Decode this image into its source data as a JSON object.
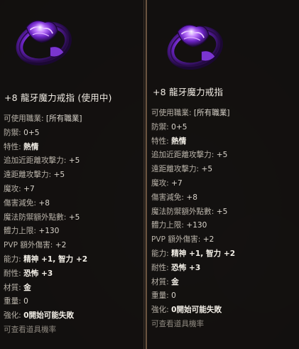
{
  "left_panel": {
    "title": "+8 龍牙魔力戒指 (使用中)",
    "stats": [
      {
        "label": "可使用職業: ",
        "value": "[所有職業]",
        "style": "plain"
      },
      {
        "label": "防禦: ",
        "value": "0+5",
        "style": "plain"
      },
      {
        "label": "特性: ",
        "value": "熱情",
        "style": "bold"
      },
      {
        "label": "追加近距離攻擊力: ",
        "value": "+5",
        "style": "plain"
      },
      {
        "label": "遠距離攻擊力: ",
        "value": "+5",
        "style": "plain"
      },
      {
        "label": "魔攻: ",
        "value": "+7",
        "style": "plain"
      },
      {
        "label": "傷害減免: ",
        "value": "+8",
        "style": "plain"
      },
      {
        "label": "魔法防禦額外點數: ",
        "value": "+5",
        "style": "plain"
      },
      {
        "label": "體力上限: ",
        "value": "+130",
        "style": "plain"
      },
      {
        "label": "PVP 額外傷害: ",
        "value": "+2",
        "style": "plain"
      },
      {
        "label": "能力: ",
        "value": "精神 +1, 智力 +2",
        "style": "bold"
      },
      {
        "label": "耐性: ",
        "value": "恐怖 +3",
        "style": "bold"
      },
      {
        "label": "材質: ",
        "value": "金",
        "style": "bold"
      },
      {
        "label": "重量: ",
        "value": "0",
        "style": "plain"
      },
      {
        "label": "強化: ",
        "value": "0開始可能失敗",
        "style": "bold"
      },
      {
        "label": "可查看道具機率",
        "value": "",
        "style": "note"
      }
    ]
  },
  "right_panel": {
    "title": "+8 龍牙魔力戒指",
    "stats": [
      {
        "label": "可使用職業: ",
        "value": "[所有職業]",
        "style": "plain"
      },
      {
        "label": "防禦: ",
        "value": "0+5",
        "style": "plain"
      },
      {
        "label": "特性: ",
        "value": "熱情",
        "style": "bold"
      },
      {
        "label": "追加近距離攻擊力: ",
        "value": "+5",
        "style": "plain"
      },
      {
        "label": "遠距離攻擊力: ",
        "value": "+5",
        "style": "plain"
      },
      {
        "label": "魔攻: ",
        "value": "+7",
        "style": "plain"
      },
      {
        "label": "傷害減免: ",
        "value": "+8",
        "style": "plain"
      },
      {
        "label": "魔法防禦額外點數: ",
        "value": "+5",
        "style": "plain"
      },
      {
        "label": "體力上限: ",
        "value": "+130",
        "style": "plain"
      },
      {
        "label": "PVP 額外傷害: ",
        "value": "+2",
        "style": "plain"
      },
      {
        "label": "能力: ",
        "value": "精神 +1, 智力 +2",
        "style": "bold"
      },
      {
        "label": "耐性: ",
        "value": "恐怖 +3",
        "style": "bold"
      },
      {
        "label": "材質: ",
        "value": "金",
        "style": "bold"
      },
      {
        "label": "重量: ",
        "value": "0",
        "style": "plain"
      },
      {
        "label": "強化: ",
        "value": "0開始可能失敗",
        "style": "bold"
      },
      {
        "label": "可查看道具機率",
        "value": "",
        "style": "note"
      }
    ]
  },
  "icons": {
    "item_icon": "purple-dragon-fang-ring-icon"
  },
  "colors": {
    "title": "#f1ece4",
    "label": "#b9b3a9",
    "value": "#d9d4cb",
    "value_bold": "#f3efe7",
    "note": "#8f8980",
    "ring_purple": "#8a3fe0",
    "panel_border": "#6b5440"
  }
}
